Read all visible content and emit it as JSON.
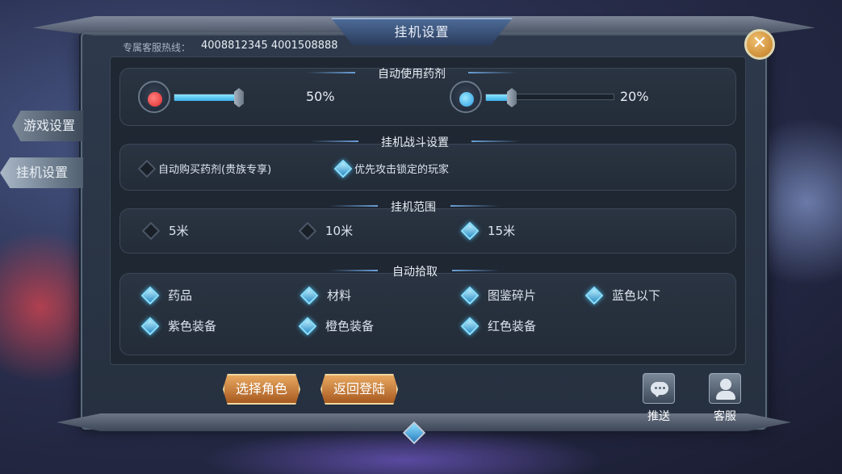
{
  "window": {
    "title": "挂机设置"
  },
  "hotline": {
    "label": "专属客服热线：",
    "numbers": "4008812345  4001508888"
  },
  "side_tabs": [
    {
      "label": "游戏设置"
    },
    {
      "label": "挂机设置"
    }
  ],
  "potion_section": {
    "title": "自动使用药剂",
    "hp": {
      "icon": "red-potion-icon",
      "percent_text": "50%",
      "value": 0.5,
      "color": "#e02a2a"
    },
    "mp": {
      "icon": "blue-potion-icon",
      "percent_text": "20%",
      "value": 0.2,
      "color": "#2a9ae0"
    }
  },
  "combat_section": {
    "title": "挂机战斗设置",
    "options": [
      {
        "label": "自动购买药剂(贵族专享)",
        "checked": false
      },
      {
        "label": "优先攻击锁定的玩家",
        "checked": true
      }
    ]
  },
  "range_section": {
    "title": "挂机范围",
    "options": [
      {
        "label": "5米",
        "checked": false
      },
      {
        "label": "10米",
        "checked": false
      },
      {
        "label": "15米",
        "checked": true
      }
    ]
  },
  "pickup_section": {
    "title": "自动拾取",
    "options": [
      {
        "label": "药品",
        "checked": true
      },
      {
        "label": "材料",
        "checked": true
      },
      {
        "label": "图鉴碎片",
        "checked": true
      },
      {
        "label": "蓝色以下",
        "checked": true
      },
      {
        "label": "紫色装备",
        "checked": true
      },
      {
        "label": "橙色装备",
        "checked": true
      },
      {
        "label": "红色装备",
        "checked": true
      }
    ]
  },
  "buttons": {
    "select_role": "选择角色",
    "back_login": "返回登陆",
    "push": "推送",
    "service": "客服"
  },
  "colors": {
    "accent": "#3ab0e8",
    "button": "#c87a38"
  }
}
